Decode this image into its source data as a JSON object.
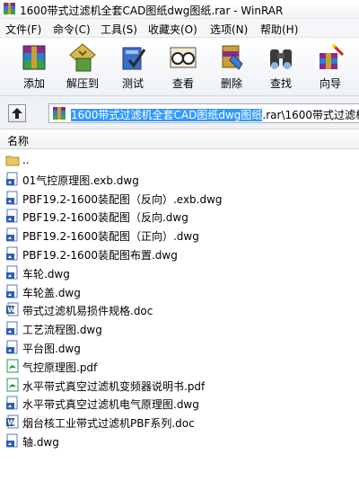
{
  "window": {
    "title": "1600带式过滤机全套CAD图纸dwg图纸.rar - WinRAR"
  },
  "menu": [
    {
      "label": "文件(F)"
    },
    {
      "label": "命令(C)"
    },
    {
      "label": "工具(S)"
    },
    {
      "label": "收藏夹(O)"
    },
    {
      "label": "选项(N)"
    },
    {
      "label": "帮助(H)"
    }
  ],
  "toolbar": [
    {
      "label": "添加",
      "icon": "add-archive-icon"
    },
    {
      "label": "解压到",
      "icon": "extract-to-icon"
    },
    {
      "label": "测试",
      "icon": "test-icon"
    },
    {
      "label": "查看",
      "icon": "view-icon"
    },
    {
      "label": "删除",
      "icon": "delete-icon"
    },
    {
      "label": "查找",
      "icon": "find-icon"
    },
    {
      "label": "向导",
      "icon": "wizard-icon"
    }
  ],
  "address": {
    "selected": "1600带式过滤机全套CAD图纸dwg图纸",
    "rest": ".rar\\1600带式过滤机"
  },
  "list": {
    "column_name": "名称",
    "items": [
      {
        "name": "..",
        "type": "folder-up"
      },
      {
        "name": "01气控原理图.exb.dwg",
        "type": "dwg"
      },
      {
        "name": "PBF19.2-1600装配图（反向）.exb.dwg",
        "type": "dwg"
      },
      {
        "name": "PBF19.2-1600装配图（反向.dwg",
        "type": "dwg"
      },
      {
        "name": "PBF19.2-1600装配图（正向）.dwg",
        "type": "dwg"
      },
      {
        "name": "PBF19.2-1600装配图布置.dwg",
        "type": "dwg"
      },
      {
        "name": "车轮.dwg",
        "type": "dwg"
      },
      {
        "name": "车轮盖.dwg",
        "type": "dwg"
      },
      {
        "name": "带式过滤机易损件规格.doc",
        "type": "doc"
      },
      {
        "name": "工艺流程图.dwg",
        "type": "dwg"
      },
      {
        "name": "平台图.dwg",
        "type": "dwg"
      },
      {
        "name": "气控原理图.pdf",
        "type": "pdf"
      },
      {
        "name": "水平带式真空过滤机变频器说明书.pdf",
        "type": "pdf"
      },
      {
        "name": "水平带式真空过滤机电气原理图.dwg",
        "type": "dwg"
      },
      {
        "name": "烟台核工业带式过滤机PBF系列.doc",
        "type": "doc"
      },
      {
        "name": "轴.dwg",
        "type": "dwg"
      }
    ]
  }
}
